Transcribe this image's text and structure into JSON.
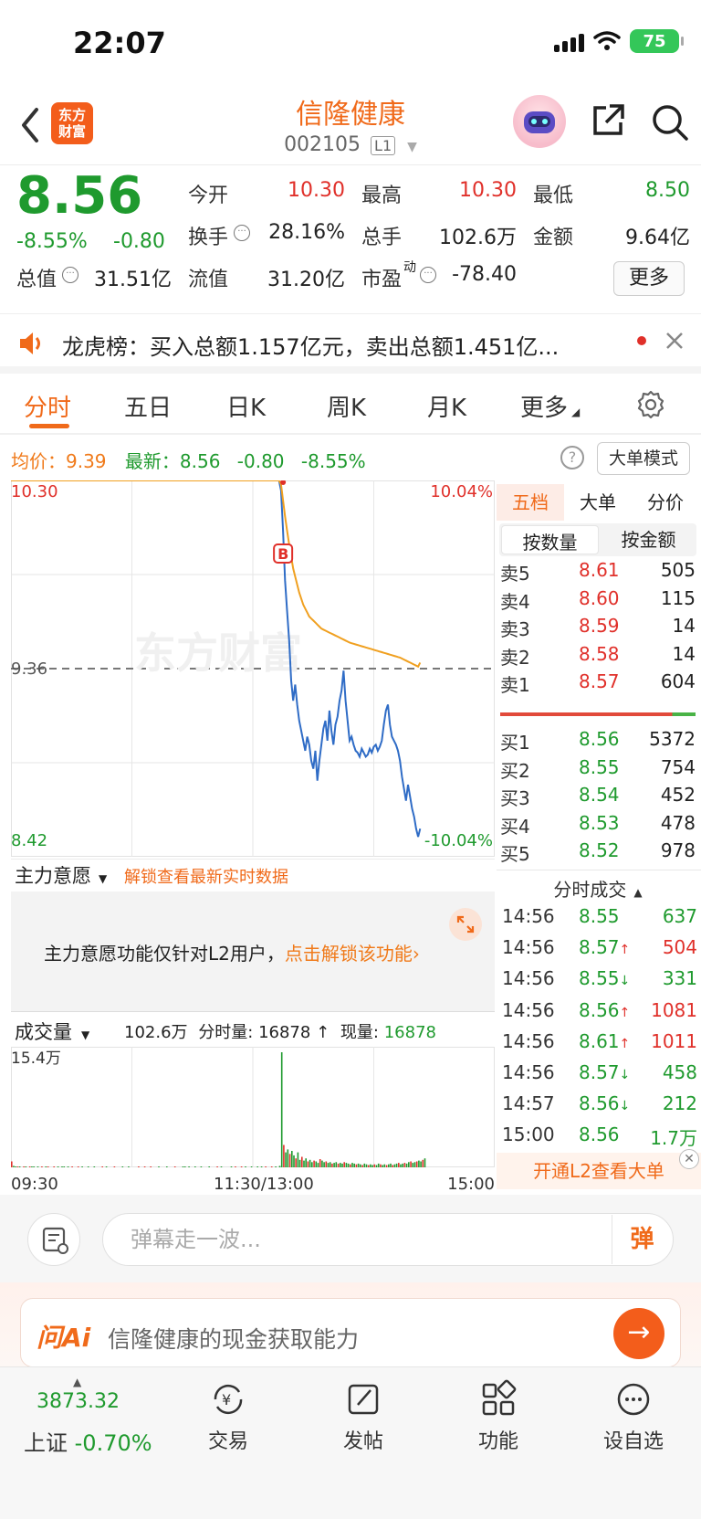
{
  "status_bar": {
    "time": "22:07",
    "battery": "75"
  },
  "header": {
    "title": "信隆健康",
    "code": "002105",
    "level": "L1",
    "logo_text_1": "东方",
    "logo_text_2": "财富"
  },
  "quote": {
    "price": "8.56",
    "change_pct": "-8.55%",
    "change_abs": "-0.80",
    "stats": [
      {
        "label": "今开",
        "value": "10.30",
        "color": "red"
      },
      {
        "label": "最高",
        "value": "10.30",
        "color": "red"
      },
      {
        "label": "最低",
        "value": "8.50",
        "color": "green"
      },
      {
        "label": "换手",
        "value": "28.16%",
        "color": "normal"
      },
      {
        "label": "总手",
        "value": "102.6万",
        "color": "normal"
      },
      {
        "label": "金额",
        "value": "9.64亿",
        "color": "normal"
      },
      {
        "label": "总值",
        "value": "31.51亿",
        "color": "normal"
      },
      {
        "label": "流值",
        "value": "31.20亿",
        "color": "normal"
      },
      {
        "label": "市盈",
        "value": "-78.40",
        "color": "normal",
        "superscript": "动"
      }
    ],
    "more_label": "更多"
  },
  "banner": {
    "text": "龙虎榜：买入总额1.157亿元，卖出总额1.451亿..."
  },
  "tabs": [
    "分时",
    "五日",
    "日K",
    "周K",
    "月K",
    "更多"
  ],
  "info_row": {
    "avg_label": "均价：",
    "avg_value": "9.39",
    "latest_label": "最新：",
    "latest_value": "8.56",
    "latest_change": "-0.80",
    "latest_pct": "-8.55%",
    "big_order_label": "大单模式"
  },
  "chart_data": {
    "type": "line",
    "y_max_label": "10.30",
    "y_min_label": "8.42",
    "y_ref_label": "9.36",
    "pct_max_label": "10.04%",
    "pct_min_label": "-10.04%",
    "ylim": [
      8.42,
      10.3
    ],
    "ref_price": 9.36,
    "marker": "B",
    "watermark": "东方财富",
    "x_labels": [
      "09:30",
      "11:30/13:00",
      "15:00"
    ],
    "series": [
      {
        "name": "最新",
        "values": [
          10.3,
          10.3,
          10.3,
          10.3,
          10.3,
          10.3,
          10.3,
          10.3,
          10.3,
          10.3,
          10.3,
          10.3,
          10.3,
          10.3,
          10.3,
          10.3,
          10.3,
          10.3,
          10.3,
          10.3,
          10.3,
          10.3,
          10.3,
          10.3,
          10.3,
          10.3,
          10.3,
          10.3,
          10.3,
          10.3,
          10.3,
          10.3,
          10.3,
          10.3,
          10.3,
          10.3,
          10.3,
          10.3,
          10.3,
          10.3,
          10.3,
          10.3,
          10.3,
          10.3,
          10.3,
          10.3,
          10.3,
          10.3,
          10.3,
          10.3,
          10.3,
          10.3,
          10.3,
          10.3,
          10.3,
          10.3,
          10.3,
          10.3,
          10.3,
          10.3,
          10.3,
          10.3,
          10.3,
          10.3,
          10.3,
          10.3,
          10.3,
          10.3,
          10.3,
          10.3,
          10.3,
          10.3,
          10.3,
          10.3,
          10.3,
          10.3,
          10.3,
          10.3,
          10.3,
          10.3,
          10.3,
          10.3,
          10.3,
          10.3,
          10.3,
          10.3,
          10.3,
          10.3,
          10.3,
          10.3,
          10.3,
          10.3,
          10.3,
          10.3,
          10.3,
          10.3,
          10.3,
          10.3,
          10.3,
          10.3,
          10.3,
          10.3,
          10.3,
          10.3,
          10.3,
          10.3,
          10.3,
          10.3,
          10.3,
          10.3,
          10.3,
          10.3,
          10.3,
          10.3,
          10.3,
          10.3,
          10.3,
          10.3,
          10.3,
          10.3,
          10.3,
          10.3,
          10.3,
          10.3,
          10.3,
          10.3,
          10.3,
          10.3,
          10.3,
          10.3,
          10.3,
          10.3,
          10.3,
          10.3,
          10.25,
          10.05,
          9.8,
          9.65,
          9.5,
          9.3,
          9.2,
          9.28,
          9.18,
          9.1,
          9.05,
          9.0,
          8.95,
          9.02,
          8.98,
          8.9,
          8.86,
          8.95,
          8.8,
          8.9,
          8.98,
          9.06,
          9.1,
          9.0,
          9.15,
          9.05,
          8.98,
          9.08,
          9.12,
          9.2,
          9.25,
          9.35,
          9.2,
          9.1,
          9.0,
          9.02,
          8.98,
          8.95,
          8.94,
          8.92,
          8.96,
          8.94,
          8.92,
          8.93,
          8.96,
          8.94,
          8.97,
          8.98,
          8.95,
          8.97,
          9.0,
          9.08,
          9.15,
          9.18,
          9.08,
          9.02,
          9.0,
          8.98,
          8.95,
          8.9,
          8.82,
          8.76,
          8.7,
          8.78,
          8.72,
          8.66,
          8.62,
          8.56,
          8.52,
          8.56
        ]
      },
      {
        "name": "均价",
        "values": [
          10.3,
          10.3,
          10.3,
          10.3,
          10.3,
          10.3,
          10.3,
          10.3,
          10.3,
          10.3,
          10.3,
          10.3,
          10.3,
          10.3,
          10.3,
          10.3,
          10.3,
          10.3,
          10.3,
          10.3,
          10.3,
          10.3,
          10.3,
          10.3,
          10.3,
          10.3,
          10.3,
          10.3,
          10.3,
          10.3,
          10.3,
          10.3,
          10.3,
          10.3,
          10.3,
          10.3,
          10.3,
          10.3,
          10.3,
          10.3,
          10.3,
          10.3,
          10.3,
          10.3,
          10.3,
          10.3,
          10.3,
          10.3,
          10.3,
          10.3,
          10.3,
          10.3,
          10.3,
          10.3,
          10.3,
          10.3,
          10.3,
          10.3,
          10.3,
          10.3,
          10.3,
          10.3,
          10.3,
          10.3,
          10.3,
          10.3,
          10.3,
          10.3,
          10.3,
          10.3,
          10.3,
          10.3,
          10.3,
          10.3,
          10.3,
          10.3,
          10.3,
          10.3,
          10.3,
          10.3,
          10.3,
          10.3,
          10.3,
          10.3,
          10.3,
          10.3,
          10.3,
          10.3,
          10.3,
          10.3,
          10.3,
          10.3,
          10.3,
          10.3,
          10.3,
          10.3,
          10.3,
          10.3,
          10.3,
          10.3,
          10.3,
          10.3,
          10.3,
          10.3,
          10.3,
          10.3,
          10.3,
          10.3,
          10.3,
          10.3,
          10.3,
          10.3,
          10.3,
          10.3,
          10.3,
          10.3,
          10.3,
          10.3,
          10.3,
          10.3,
          10.3,
          10.3,
          10.3,
          10.3,
          10.3,
          10.3,
          10.3,
          10.3,
          10.3,
          10.3,
          10.3,
          10.3,
          10.3,
          10.3,
          10.28,
          10.2,
          10.12,
          10.05,
          9.98,
          9.92,
          9.86,
          9.82,
          9.78,
          9.74,
          9.71,
          9.68,
          9.66,
          9.64,
          9.62,
          9.61,
          9.6,
          9.59,
          9.58,
          9.57,
          9.56,
          9.555,
          9.55,
          9.545,
          9.54,
          9.535,
          9.53,
          9.525,
          9.52,
          9.515,
          9.51,
          9.505,
          9.5,
          9.495,
          9.49,
          9.487,
          9.484,
          9.481,
          9.478,
          9.475,
          9.472,
          9.469,
          9.466,
          9.463,
          9.46,
          9.457,
          9.454,
          9.451,
          9.448,
          9.445,
          9.442,
          9.439,
          9.436,
          9.433,
          9.43,
          9.427,
          9.424,
          9.421,
          9.418,
          9.415,
          9.41,
          9.405,
          9.4,
          9.395,
          9.39,
          9.385,
          9.38,
          9.375,
          9.37,
          9.39
        ]
      }
    ],
    "volume": {
      "max_label": "15.4万",
      "values": [
        8,
        2,
        1,
        1,
        1,
        0,
        1,
        1,
        0,
        1,
        1,
        1,
        0,
        1,
        0,
        1,
        0,
        1,
        1,
        0,
        0,
        1,
        0,
        1,
        0,
        1,
        1,
        0,
        1,
        0,
        1,
        0,
        0,
        1,
        0,
        1,
        0,
        0,
        1,
        0,
        0,
        1,
        0,
        0,
        0,
        1,
        0,
        1,
        0,
        0,
        0,
        1,
        0,
        0,
        0,
        1,
        0,
        0,
        1,
        0,
        0,
        0,
        0,
        1,
        0,
        0,
        1,
        0,
        0,
        1,
        0,
        0,
        0,
        1,
        0,
        0,
        0,
        1,
        0,
        0,
        0,
        1,
        0,
        0,
        0,
        1,
        1,
        0,
        1,
        0,
        0,
        1,
        0,
        0,
        1,
        0,
        0,
        0,
        1,
        0,
        0,
        0,
        1,
        0,
        1,
        0,
        0,
        0,
        0,
        1,
        0,
        1,
        0,
        0,
        1,
        0,
        1,
        0,
        0,
        1,
        0,
        0,
        1,
        0,
        1,
        0,
        1,
        0,
        0,
        1,
        0,
        1,
        0,
        2,
        154,
        30,
        20,
        24,
        18,
        22,
        16,
        12,
        20,
        10,
        14,
        9,
        12,
        8,
        10,
        7,
        9,
        8,
        6,
        11,
        9,
        7,
        8,
        6,
        7,
        5,
        6,
        7,
        5,
        6,
        5,
        7,
        6,
        5,
        4,
        6,
        5,
        4,
        5,
        4,
        3,
        5,
        4,
        3,
        4,
        3,
        4,
        3,
        5,
        4,
        3,
        4,
        3,
        4,
        5,
        3,
        4,
        5,
        6,
        4,
        5,
        6,
        5,
        7,
        8,
        6,
        7,
        8,
        9,
        8,
        10,
        12
      ],
      "colors": "mixed"
    }
  },
  "order_book": {
    "tabs": [
      "五档",
      "大单",
      "分价"
    ],
    "mode_tabs": [
      "按数量",
      "按金额"
    ],
    "asks": [
      {
        "name": "卖5",
        "price": "8.61",
        "vol": "505",
        "color": "red"
      },
      {
        "name": "卖4",
        "price": "8.60",
        "vol": "115",
        "color": "red"
      },
      {
        "name": "卖3",
        "price": "8.59",
        "vol": "14",
        "color": "red"
      },
      {
        "name": "卖2",
        "price": "8.58",
        "vol": "14",
        "color": "red"
      },
      {
        "name": "卖1",
        "price": "8.57",
        "vol": "604",
        "color": "red"
      }
    ],
    "bids": [
      {
        "name": "买1",
        "price": "8.56",
        "vol": "5372",
        "color": "green"
      },
      {
        "name": "买2",
        "price": "8.55",
        "vol": "754",
        "color": "green"
      },
      {
        "name": "买3",
        "price": "8.54",
        "vol": "452",
        "color": "green"
      },
      {
        "name": "买4",
        "price": "8.53",
        "vol": "478",
        "color": "green"
      },
      {
        "name": "买5",
        "price": "8.52",
        "vol": "978",
        "color": "green"
      }
    ],
    "ticks_title": "分时成交",
    "ticks": [
      {
        "time": "14:56",
        "price": "8.55",
        "arrow": "",
        "vol": "637",
        "color": "green",
        "vcolor": "green"
      },
      {
        "time": "14:56",
        "price": "8.57",
        "arrow": "↑",
        "vol": "504",
        "color": "green",
        "vcolor": "red"
      },
      {
        "time": "14:56",
        "price": "8.55",
        "arrow": "↓",
        "vol": "331",
        "color": "green",
        "vcolor": "green"
      },
      {
        "time": "14:56",
        "price": "8.56",
        "arrow": "↑",
        "vol": "1081",
        "color": "green",
        "vcolor": "red"
      },
      {
        "time": "14:56",
        "price": "8.61",
        "arrow": "↑",
        "vol": "1011",
        "color": "green",
        "vcolor": "red"
      },
      {
        "time": "14:56",
        "price": "8.57",
        "arrow": "↓",
        "vol": "458",
        "color": "green",
        "vcolor": "green"
      },
      {
        "time": "14:57",
        "price": "8.56",
        "arrow": "↓",
        "vol": "212",
        "color": "green",
        "vcolor": "green"
      },
      {
        "time": "15:00",
        "price": "8.56",
        "arrow": "",
        "vol": "1.7万",
        "color": "green",
        "vcolor": "green"
      }
    ],
    "l2_banner": "开通L2查看大单"
  },
  "indicator": {
    "select_label": "主力意愿",
    "unlock_text": "解锁查看最新实时数据",
    "message_prefix": "主力意愿功能仅针对L2用户，",
    "message_link": "点击解锁该功能"
  },
  "volume_bar": {
    "select_label": "成交量",
    "total": "102.6万",
    "fenshi_label": "分时量:",
    "fenshi_value": "16878",
    "now_label": "现量:",
    "now_value": "16878"
  },
  "comment": {
    "placeholder": "弹幕走一波...",
    "danmu_label": "弹"
  },
  "ai": {
    "logo": "问Ai",
    "text": "信隆健康的现金获取能力"
  },
  "bottom_nav": {
    "index_value": "3873.32",
    "index_name": "上证",
    "index_pct": "-0.70%",
    "items": [
      "交易",
      "发帖",
      "功能",
      "设自选"
    ]
  }
}
